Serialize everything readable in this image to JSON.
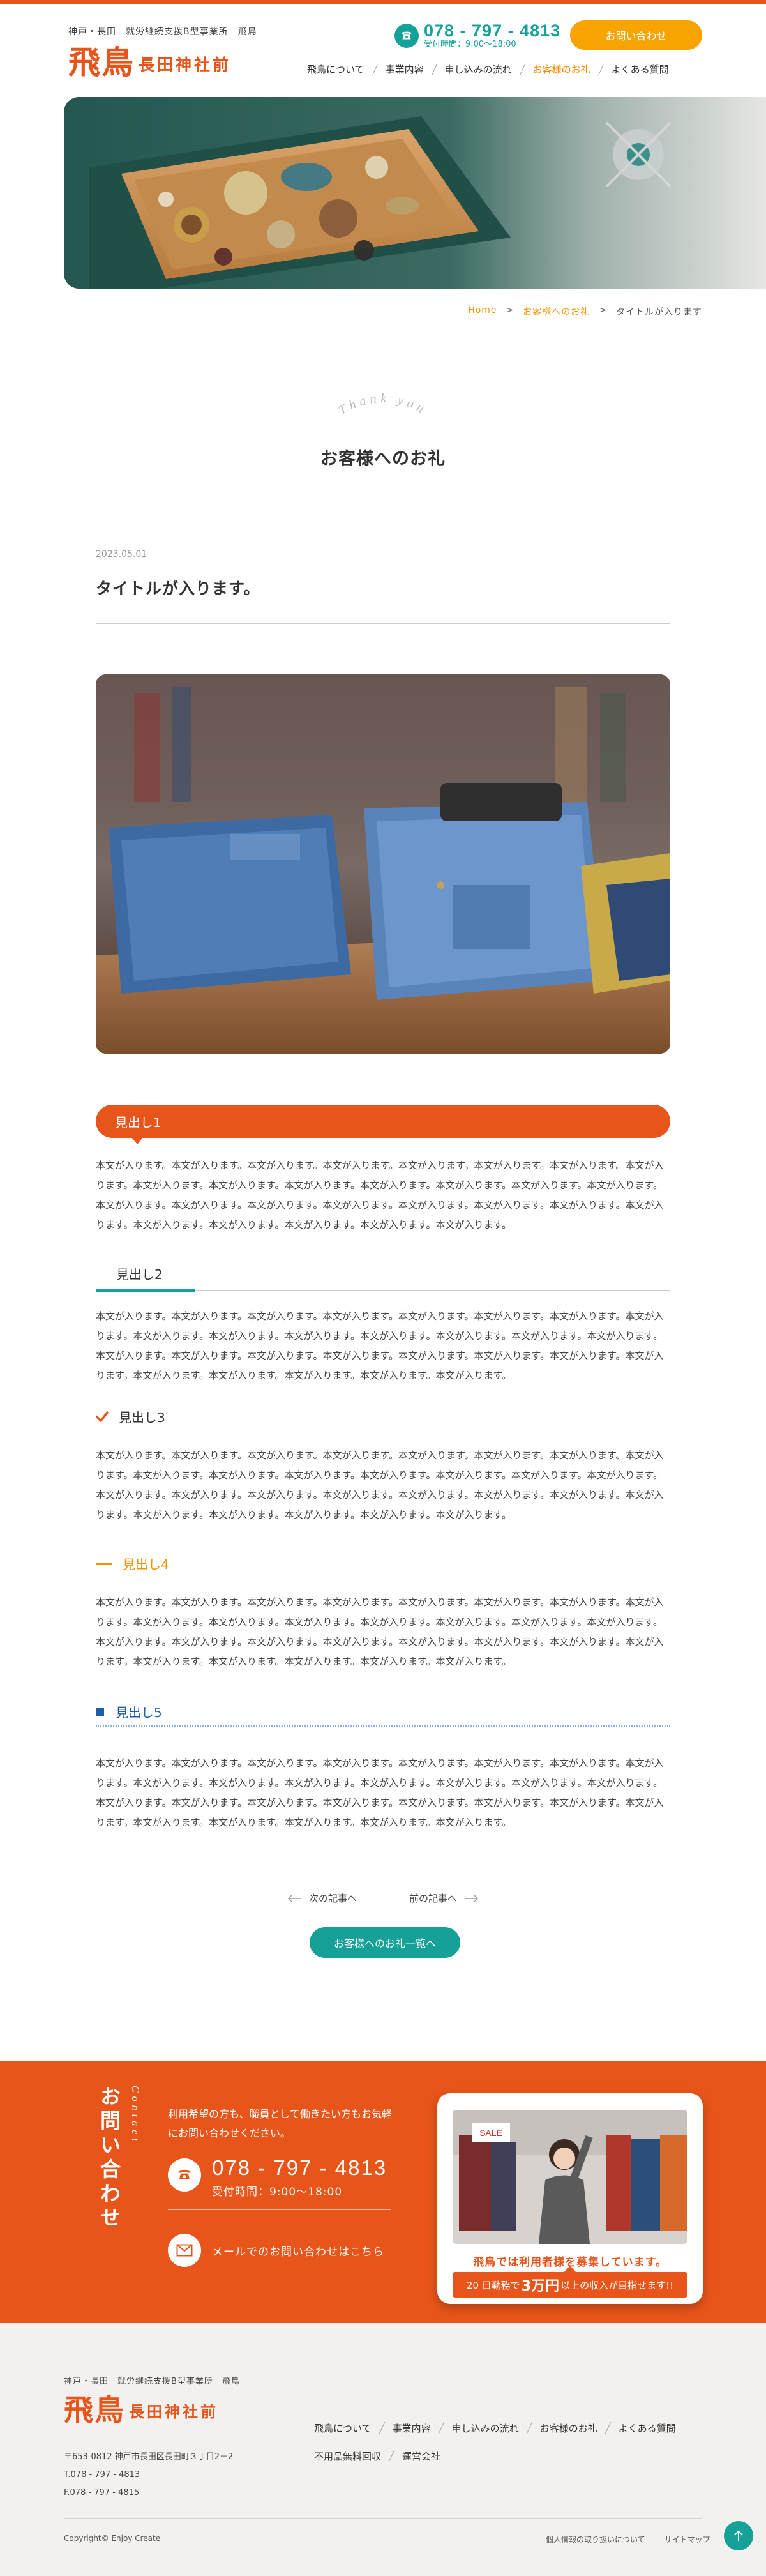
{
  "header": {
    "subtitle": "神戸・長田　就労継続支援B型事業所　飛鳥",
    "logo_main": "飛鳥",
    "logo_sub": "長田神社前",
    "phone": "078 - 797 - 4813",
    "hours": "受付時間：9:00〜18:00",
    "contact_label": "お問い合わせ",
    "nav": [
      {
        "label": "飛鳥について"
      },
      {
        "label": "事業内容"
      },
      {
        "label": "申し込みの流れ"
      },
      {
        "label": "お客様のお礼"
      },
      {
        "label": "よくある質問"
      }
    ]
  },
  "breadcrumb": {
    "home": "Home",
    "sep": ">",
    "parent": "お客様へのお礼",
    "current": "タイトルが入ります"
  },
  "page": {
    "en_title": "Thank you",
    "title": "お客様へのお礼"
  },
  "post": {
    "date": "2023.05.01",
    "title": "タイトルが入ります。",
    "headings": {
      "h1": "見出し1",
      "h2": "見出し2",
      "h3": "見出し3",
      "h4": "見出し4",
      "h5": "見出し5"
    },
    "body": "本文が入ります。本文が入ります。本文が入ります。本文が入ります。本文が入ります。本文が入ります。本文が入ります。本文が入ります。本文が入ります。本文が入ります。本文が入ります。本文が入ります。本文が入ります。本文が入ります。本文が入ります。本文が入ります。本文が入ります。本文が入ります。本文が入ります。本文が入ります。本文が入ります。本文が入ります。本文が入ります。本文が入ります。本文が入ります。本文が入ります。本文が入ります。本文が入ります。"
  },
  "pager": {
    "next": "次の記事へ",
    "prev": "前の記事へ",
    "archive": "お客様へのお礼一覧へ"
  },
  "contact": {
    "title_jp": "お問い合わせ",
    "title_en": "Contact",
    "lead": "利用希望の方も、職員として働きたい方もお気軽にお問い合わせください。",
    "phone": "078 - 797 - 4813",
    "hours": "受付時間：9:00〜18:00",
    "mail_label": "メールでのお問い合わせはこちら"
  },
  "recruit": {
    "title": "飛鳥では利用者様を募集しています。",
    "banner_pre": "20 日勤務で",
    "banner_big": "3万円",
    "banner_post": "以上の収入が目指せます!!"
  },
  "footer": {
    "subtitle": "神戸・長田　就労継続支援B型事業所　飛鳥",
    "logo_main": "飛鳥",
    "logo_sub": "長田神社前",
    "address": "〒653-0812 神戸市長田区長田町３丁目2－2",
    "tel": "T.078 - 797 - 4813",
    "fax": "F.078 - 797 - 4815",
    "nav_row1": [
      {
        "label": "飛鳥について"
      },
      {
        "label": "事業内容"
      },
      {
        "label": "申し込みの流れ"
      },
      {
        "label": "お客様のお礼"
      },
      {
        "label": "よくある質問"
      }
    ],
    "nav_row2": [
      {
        "label": "不用品無料回収"
      },
      {
        "label": "運営会社"
      }
    ],
    "copyright": "Copyright© Enjoy Create",
    "privacy": "個人情報の取り扱いについて",
    "sitemap": "サイトマップ"
  },
  "colors": {
    "brand_orange": "#e8551a",
    "accent_yellow": "#f7a400",
    "teal": "#16a198",
    "blue": "#1c5fa8"
  }
}
